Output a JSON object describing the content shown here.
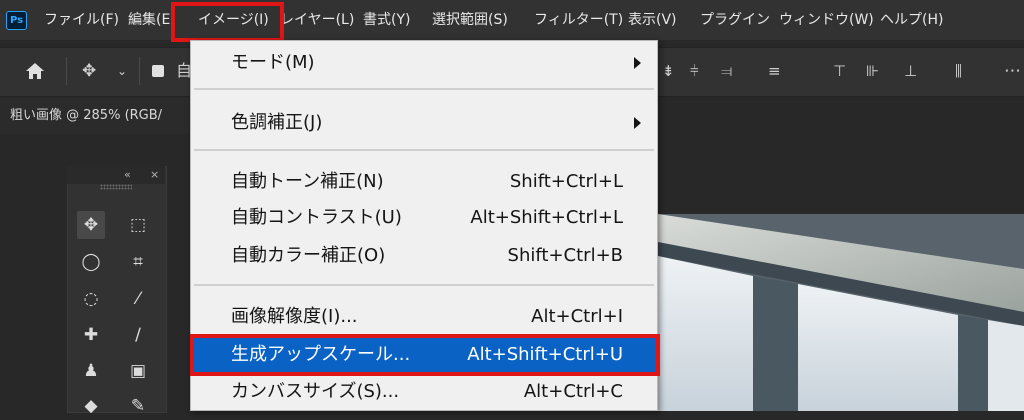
{
  "app": {
    "logo_text": "Ps"
  },
  "menubar": {
    "items": [
      {
        "label": "ファイル(F)"
      },
      {
        "label": "編集(E)"
      },
      {
        "label": "イメージ(I)"
      },
      {
        "label": "レイヤー(L)"
      },
      {
        "label": "書式(Y)"
      },
      {
        "label": "選択範囲(S)"
      },
      {
        "label": "フィルター(T)"
      },
      {
        "label": "表示(V)"
      },
      {
        "label": "プラグイン"
      },
      {
        "label": "ウィンドウ(W)"
      },
      {
        "label": "ヘルプ(H)"
      }
    ],
    "open_menu_label": "イメージ(I)"
  },
  "options": {
    "auto_select_label": "自"
  },
  "document": {
    "tab_title": "粗い画像 @ 285% (RGB/"
  },
  "tools": {
    "collapse_label": "«",
    "close_label": "×"
  },
  "image_menu": {
    "items": [
      {
        "label": "モード(M)",
        "shortcut": "",
        "submenu": true
      },
      {
        "label": "色調補正(J)",
        "shortcut": "",
        "submenu": true
      },
      {
        "label": "自動トーン補正(N)",
        "shortcut": "Shift+Ctrl+L"
      },
      {
        "label": "自動コントラスト(U)",
        "shortcut": "Alt+Shift+Ctrl+L"
      },
      {
        "label": "自動カラー補正(O)",
        "shortcut": "Shift+Ctrl+B"
      },
      {
        "label": "画像解像度(I)...",
        "shortcut": "Alt+Ctrl+I"
      },
      {
        "label": "生成アップスケール...",
        "shortcut": "Alt+Shift+Ctrl+U",
        "selected": true
      },
      {
        "label": "カンバスサイズ(S)...",
        "shortcut": "Alt+Ctrl+C"
      }
    ]
  },
  "colors": {
    "highlight_box": "#e01515",
    "selection": "#0a63c4",
    "menu_bg": "#f0f0f0"
  }
}
